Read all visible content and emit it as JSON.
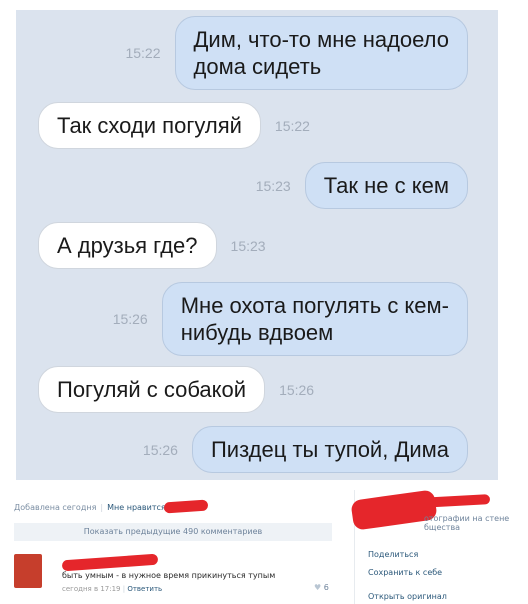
{
  "chat": {
    "messages": [
      {
        "direction": "out",
        "text_line1": "Дим, что-то мне надоело",
        "text_line2": "дома сидеть",
        "time": "15:22"
      },
      {
        "direction": "in",
        "text": "Так сходи погуляй",
        "time": "15:22"
      },
      {
        "direction": "out",
        "text": "Так не с кем",
        "time": "15:23"
      },
      {
        "direction": "in",
        "text": "А друзья где?",
        "time": "15:23"
      },
      {
        "direction": "out",
        "text_line1": "Мне охота погулять с кем-",
        "text_line2": "нибудь вдвоем",
        "time": "15:26"
      },
      {
        "direction": "in",
        "text": "Погуляй с собакой",
        "time": "15:26"
      },
      {
        "direction": "out",
        "text": "Пиздец ты тупой, Дима",
        "time": "15:26"
      }
    ]
  },
  "post": {
    "added": "Добавлена сегодня",
    "like_label": "Мне нравится",
    "show_more": "Показать предыдущие 490 комментариев",
    "comment": {
      "text": "быть умным - в нужное время прикинуться тупым",
      "time": "сегодня в 17:19",
      "reply": "Ответить",
      "likes": "6"
    },
    "side": {
      "desc_line1": "отографии на стене",
      "desc_line2": "бщества",
      "share": "Поделиться",
      "save": "Сохранить к себе",
      "open": "Открыть оригинал"
    }
  },
  "colors": {
    "chat_bg": "#dbe3ee",
    "outgoing_bubble": "#cfe0f5",
    "incoming_bubble": "#ffffff",
    "redaction": "#e5262b",
    "link": "#2b587a"
  }
}
